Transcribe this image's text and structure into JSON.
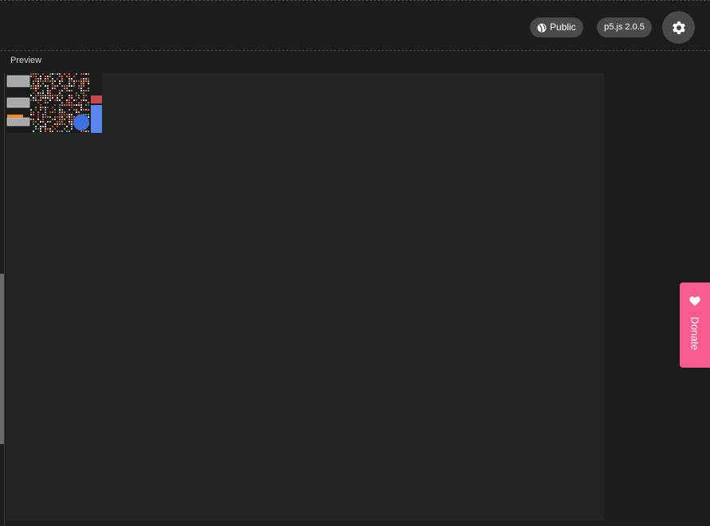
{
  "header": {
    "visibility_label": "Public",
    "version_label": "p5.js 2.0.5"
  },
  "preview": {
    "label": "Preview"
  },
  "donate": {
    "label": "Donate"
  },
  "colors": {
    "background": "#1c1c1c",
    "canvas": "#222323",
    "pill": "#4a4a4a",
    "donate": "#f75b8f"
  },
  "icons": {
    "visibility": "globe-icon",
    "settings": "gear-icon",
    "donate": "heart-icon"
  }
}
